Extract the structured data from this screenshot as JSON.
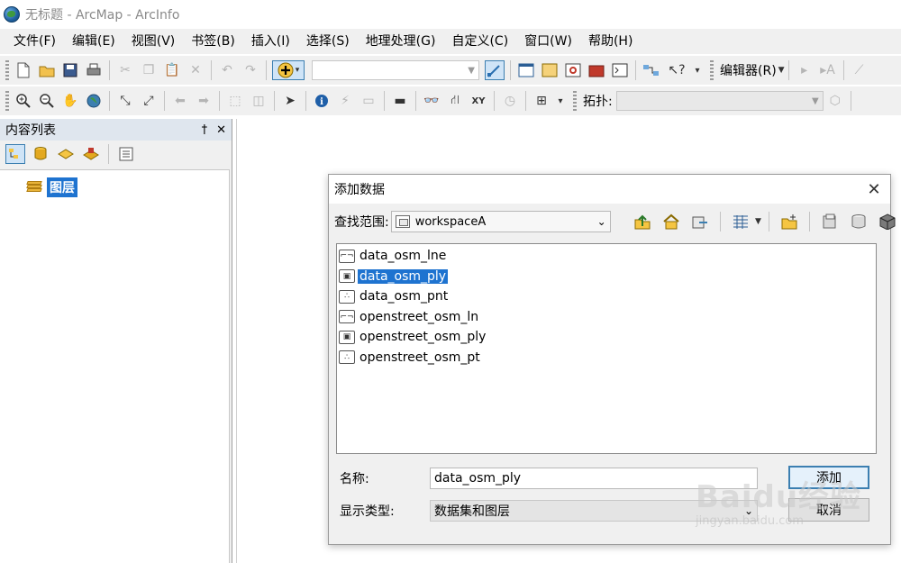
{
  "window": {
    "title": "无标题 - ArcMap - ArcInfo"
  },
  "menu": [
    "文件(F)",
    "编辑(E)",
    "视图(V)",
    "书签(B)",
    "插入(I)",
    "选择(S)",
    "地理处理(G)",
    "自定义(C)",
    "窗口(W)",
    "帮助(H)"
  ],
  "toolbar1": {
    "editor_label": "编辑器(R)"
  },
  "toolbar2": {
    "topology_label": "拓扑:"
  },
  "toc": {
    "title": "内容列表",
    "pin_glyph": "†",
    "close_glyph": "✕",
    "layer_root": "图层"
  },
  "dialog": {
    "title": "添加数据",
    "lookin_label": "查找范围:",
    "lookin_value": "workspaceA",
    "files": [
      {
        "name": "data_osm_lne",
        "kind": "line",
        "selected": false
      },
      {
        "name": "data_osm_ply",
        "kind": "polygon",
        "selected": true
      },
      {
        "name": "data_osm_pnt",
        "kind": "point",
        "selected": false
      },
      {
        "name": "openstreet_osm_ln",
        "kind": "line",
        "selected": false
      },
      {
        "name": "openstreet_osm_ply",
        "kind": "polygon",
        "selected": false
      },
      {
        "name": "openstreet_osm_pt",
        "kind": "point",
        "selected": false
      }
    ],
    "name_label": "名称:",
    "name_value": "data_osm_ply",
    "type_label": "显示类型:",
    "type_value": "数据集和图层",
    "add_button": "添加",
    "cancel_button": "取消"
  },
  "watermark": {
    "logo": "Baidu经验",
    "url": "jingyan.baidu.com"
  }
}
